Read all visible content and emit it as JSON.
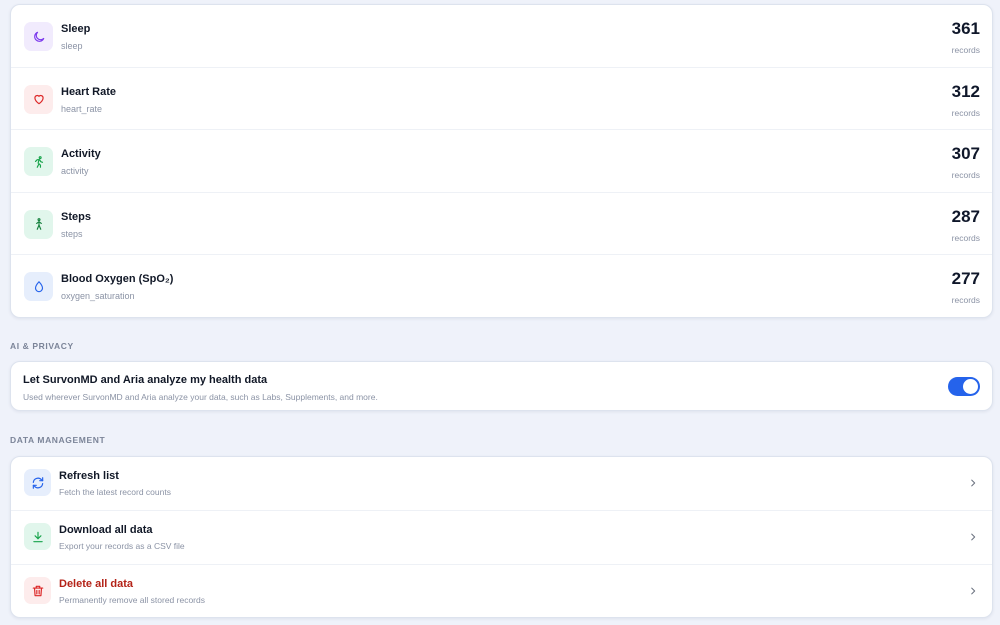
{
  "records": {
    "items": [
      {
        "title": "Sleep",
        "key": "sleep",
        "count": "361",
        "unit": "records",
        "icon": "moon-icon",
        "icon_bg": "#f1ebfd",
        "icon_color": "#7c3aed"
      },
      {
        "title": "Heart Rate",
        "key": "heart_rate",
        "count": "312",
        "unit": "records",
        "icon": "heart-icon",
        "icon_bg": "#fdecec",
        "icon_color": "#dc2626"
      },
      {
        "title": "Activity",
        "key": "activity",
        "count": "307",
        "unit": "records",
        "icon": "running-icon",
        "icon_bg": "#e1f6ec",
        "icon_color": "#16a34a"
      },
      {
        "title": "Steps",
        "key": "steps",
        "count": "287",
        "unit": "records",
        "icon": "walking-icon",
        "icon_bg": "#e1f6ec",
        "icon_color": "#15803d"
      },
      {
        "title": "Blood Oxygen (SpO₂)",
        "key": "oxygen_saturation",
        "count": "277",
        "unit": "records",
        "icon": "droplet-icon",
        "icon_bg": "#e6eefc",
        "icon_color": "#2563eb"
      }
    ]
  },
  "ai_privacy": {
    "section_label": "AI & PRIVACY",
    "title": "Let SurvonMD and Aria analyze my health data",
    "description": "Used wherever SurvonMD and Aria analyze your data, such as Labs, Supplements, and more.",
    "toggle_on": true,
    "toggle_color": "#2563eb"
  },
  "data_management": {
    "section_label": "DATA MANAGEMENT",
    "items": [
      {
        "title": "Refresh list",
        "description": "Fetch the latest record counts",
        "icon": "refresh-icon",
        "icon_bg": "#e6eefc",
        "icon_color": "#2563eb"
      },
      {
        "title": "Download all data",
        "description": "Export your records as a CSV file",
        "icon": "download-icon",
        "icon_bg": "#e1f6ec",
        "icon_color": "#16a34a"
      },
      {
        "title": "Delete all data",
        "description": "Permanently remove all stored records",
        "icon": "trash-icon",
        "icon_bg": "#fdecec",
        "icon_color": "#dc2626",
        "danger": true
      }
    ]
  }
}
